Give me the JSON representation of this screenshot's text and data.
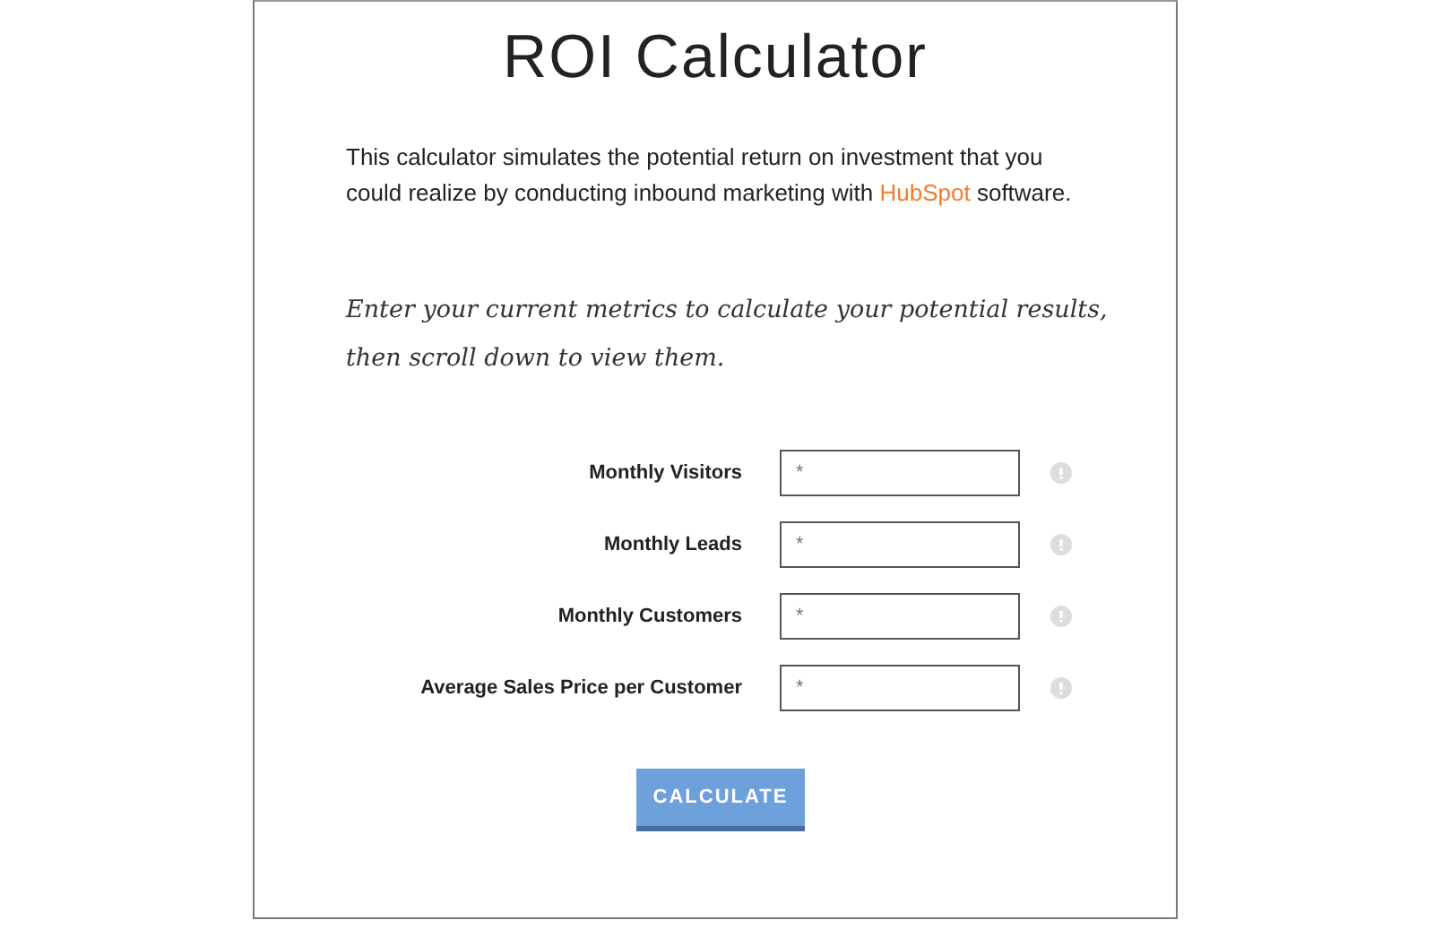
{
  "title": "ROI Calculator",
  "intro": {
    "text_before": "This calculator simulates the potential return on investment that you could realize by conducting inbound marketing with",
    "link": "HubSpot",
    "text_after": "software."
  },
  "instructions": "Enter your current metrics to calculate your potential results, then scroll down to view them.",
  "fields": [
    {
      "label": "Monthly Visitors",
      "placeholder": "*"
    },
    {
      "label": "Monthly Leads",
      "placeholder": "*"
    },
    {
      "label": "Monthly Customers",
      "placeholder": "*"
    },
    {
      "label": "Average Sales Price per Customer",
      "placeholder": "*"
    }
  ],
  "button": "CALCULATE"
}
